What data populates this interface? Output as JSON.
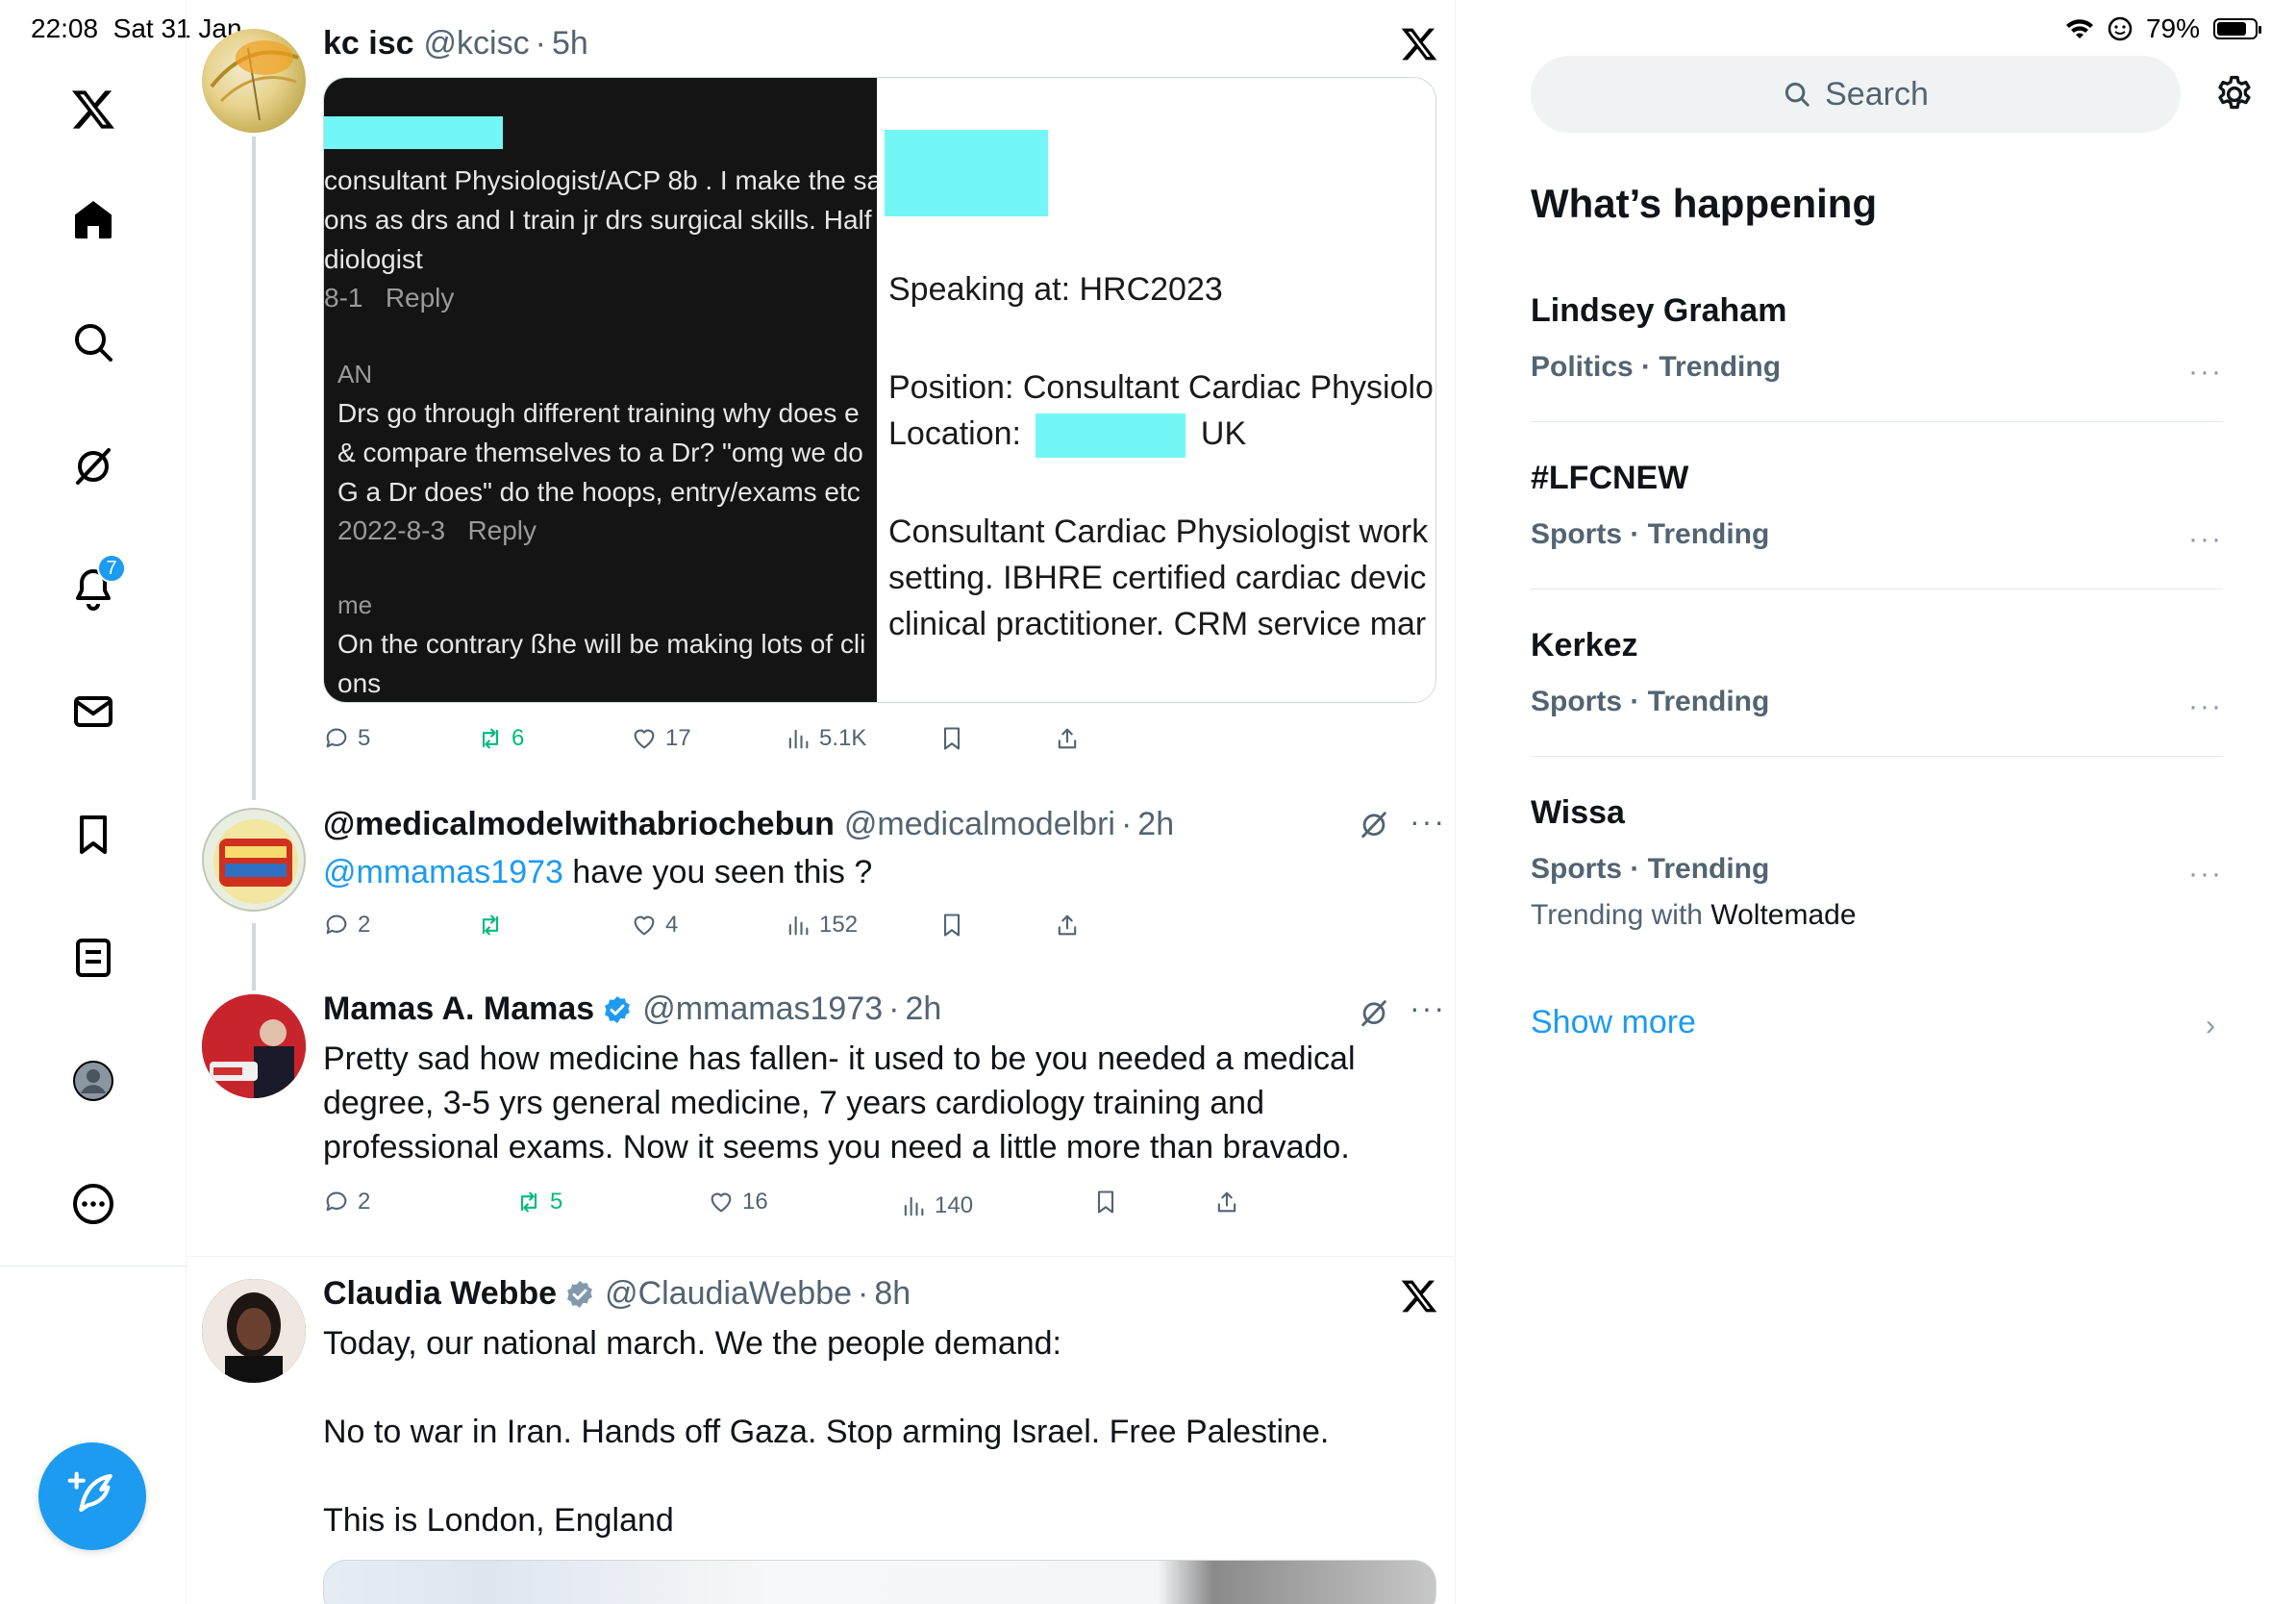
{
  "status_bar": {
    "time": "22:08",
    "date": "Sat 31 Jan",
    "battery": "79%",
    "battery_level": 0.79
  },
  "nav": {
    "notifications_badge": "7",
    "items": [
      "x-logo",
      "home",
      "explore",
      "grok",
      "notifications",
      "messages",
      "bookmarks",
      "lists",
      "profile",
      "more"
    ]
  },
  "tweets": [
    {
      "name": "kc isc",
      "handle": "@kcisc",
      "sep": "·",
      "time": "5h",
      "media": {
        "left_lines": [
          "consultant Physiologist/ACP 8b . I make the sa",
          "ons as drs and I train jr drs surgical skills. Half",
          "diologist",
          "AN",
          "Drs go through different training why does e",
          "& compare themselves to a Dr? \"omg we do",
          "G a Dr does\" do the hoops, entry/exams etc",
          "me",
          "On the contrary ßhe will be making lots of cli",
          "ons"
        ],
        "reply_row_1_date": "8-1",
        "reply_row_1_label": "Reply",
        "reply_row_2_date": "2022-8-3",
        "reply_row_2_label": "Reply",
        "right_lines": [
          "Speaking at: HRC2023",
          "Position: Consultant Cardiac Physiolo",
          "Location:",
          "UK",
          "Consultant Cardiac Physiologist work",
          "setting. IBHRE certified cardiac devic",
          "clinical practitioner. CRM service mar"
        ]
      },
      "stats": {
        "replies": "5",
        "reposts": "6",
        "likes": "17",
        "views": "5.1K"
      }
    },
    {
      "name": "@medicalmodelwithabriochebun",
      "handle": "@medicalmodelbri",
      "sep": "·",
      "time": "2h",
      "mention": "@mmamas1973",
      "text": " have you seen this ?",
      "stats": {
        "replies": "2",
        "reposts": "",
        "likes": "4",
        "views": "152"
      }
    },
    {
      "name": "Mamas A. Mamas",
      "handle": "@mmamas1973",
      "sep": "·",
      "time": "2h",
      "text_lines": [
        "Pretty sad how medicine has fallen- it used to be you needed a medical",
        "degree, 3-5 yrs general medicine, 7 years cardiology training and",
        "professional exams. Now it seems you need a little more than bravado."
      ],
      "stats": {
        "replies": "2",
        "reposts": "5",
        "likes": "16",
        "views": "140"
      }
    },
    {
      "name": "Claudia Webbe",
      "handle": "@ClaudiaWebbe",
      "sep": "·",
      "time": "8h",
      "text_lines": [
        "Today, our national march. We the people demand:",
        "No to war in Iran. Hands off Gaza. Stop arming Israel. Free Palestine.",
        "This is London, England"
      ]
    }
  ],
  "search": {
    "placeholder": "Search"
  },
  "sidebar": {
    "heading": "What’s happening",
    "trends": [
      {
        "title": "Lindsey Graham",
        "category": "Politics · Trending"
      },
      {
        "title": "#LFCNEW",
        "category": "Sports · Trending"
      },
      {
        "title": "Kerkez",
        "category": "Sports · Trending"
      },
      {
        "title": "Wissa",
        "category": "Sports · Trending",
        "with_prefix": "Trending with",
        "with_name": "Woltemade"
      }
    ],
    "show_more": "Show more"
  },
  "colors": {
    "accent": "#1d9bf0",
    "repost_green": "#00ba7c",
    "secondary_text": "#536471",
    "redaction": "#73f7f6"
  }
}
